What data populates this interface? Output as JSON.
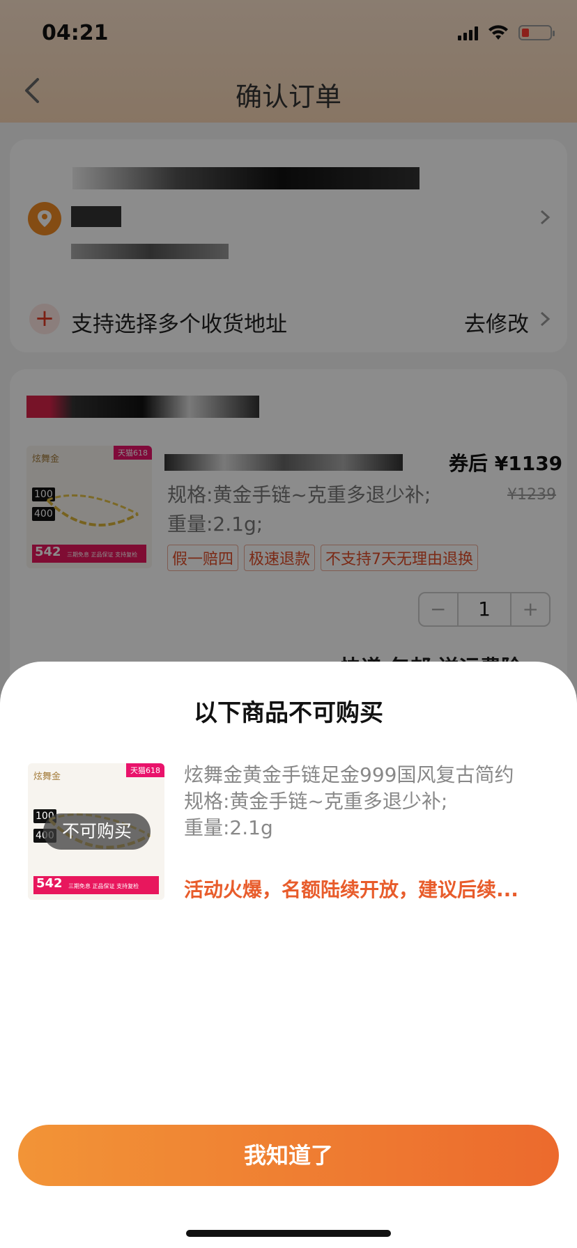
{
  "status_bar": {
    "time": "04:21"
  },
  "nav": {
    "title": "确认订单"
  },
  "address": {
    "multi_label": "支持选择多个收货地址",
    "edit_label": "去修改"
  },
  "product": {
    "coupon_price": "券后 ¥1139",
    "original_price": "¥1239",
    "spec": "规格:黄金手链~克重多退少补;重量:2.1g;",
    "tags": [
      "假一赔四",
      "极速退款",
      "不支持7天无理由退换"
    ],
    "quantity": "1",
    "decrease": "−",
    "increase": "+",
    "shipping": "快递 包邮 送运费险"
  },
  "thumb": {
    "brand": "炫舞金",
    "tmall": "天猫618",
    "badge_100": "100",
    "badge_400": "400",
    "price": "542",
    "promo": "三期免息 正品保证 支持复检"
  },
  "sheet": {
    "title": "以下商品不可购买",
    "badge": "不可购买",
    "item_name": "炫舞金黄金手链足金999国风复古简约",
    "item_spec1": "规格:黄金手链~克重多退少补;",
    "item_spec2": "重量:2.1g",
    "reason": "活动火爆，名额陆续开放，建议后续...",
    "button": "我知道了"
  },
  "colors": {
    "accent": "#ec6a2d",
    "warning": "#e85c2b"
  }
}
